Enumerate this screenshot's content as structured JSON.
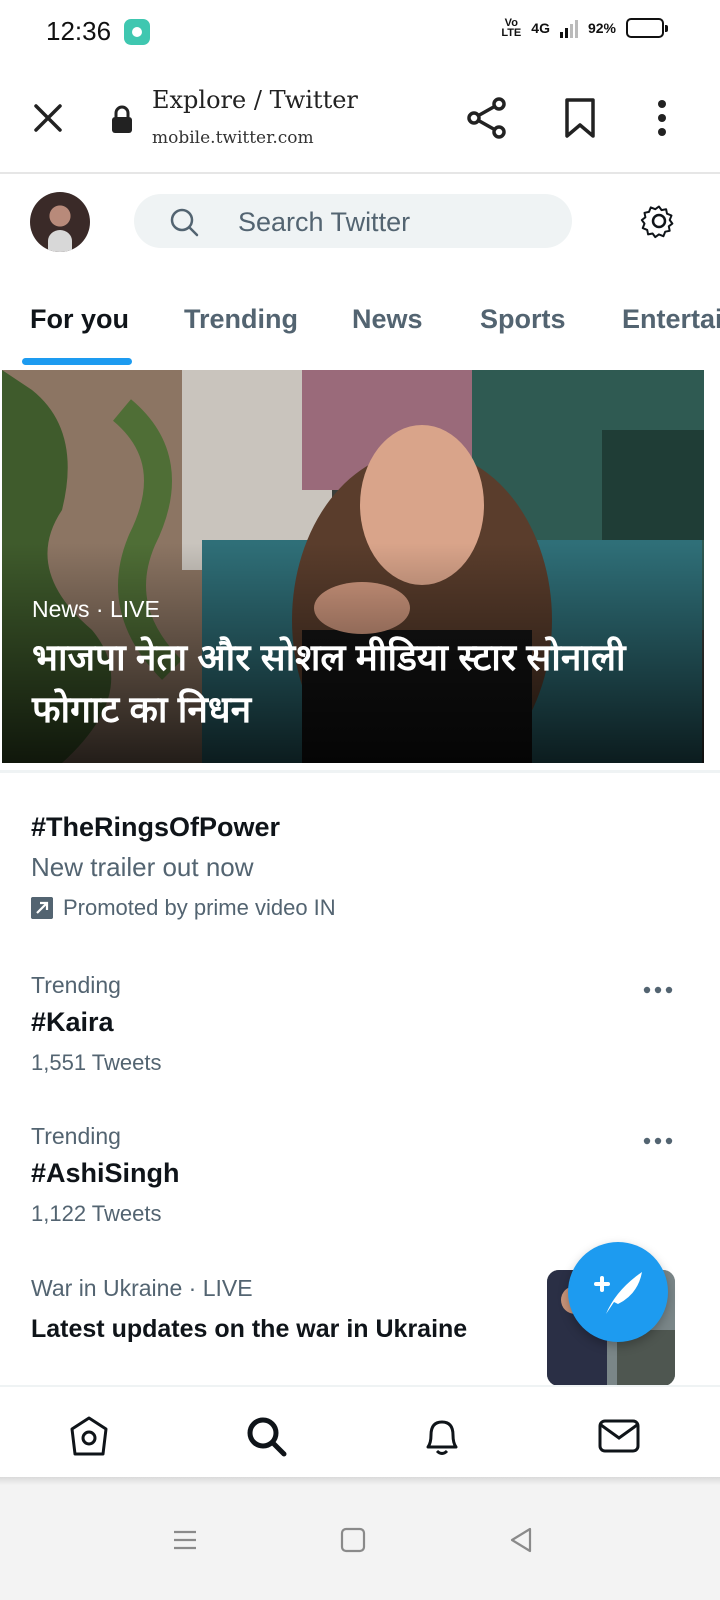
{
  "status_bar": {
    "time": "12:36",
    "volte": "Vo LTE",
    "network": "4G",
    "battery": "92%"
  },
  "browser": {
    "page_title": "Explore / Twitter",
    "url": "mobile.twitter.com"
  },
  "header": {
    "search_placeholder": "Search Twitter"
  },
  "tabs": [
    {
      "label": "For you",
      "active": true
    },
    {
      "label": "Trending",
      "active": false
    },
    {
      "label": "News",
      "active": false
    },
    {
      "label": "Sports",
      "active": false
    },
    {
      "label": "Entertainment",
      "active": false
    }
  ],
  "hero": {
    "category": "News",
    "status": "LIVE",
    "separator": "·",
    "title": "भाजपा नेता और सोशल मीडिया स्टार सोनाली फोगाट का निधन"
  },
  "trends": {
    "promoted": {
      "hashtag": "#TheRingsOfPower",
      "subtitle": "New trailer out now",
      "promoted_by": "Promoted by prime video IN"
    },
    "items": [
      {
        "context": "Trending",
        "name": "#Kaira",
        "count": "1,551 Tweets"
      },
      {
        "context": "Trending",
        "name": "#AshiSingh",
        "count": "1,122 Tweets"
      }
    ],
    "news": {
      "context": "War in Ukraine",
      "separator": "·",
      "status": "LIVE",
      "title": "Latest updates on the war in Ukraine"
    }
  },
  "colors": {
    "accent": "#1d9bf0",
    "text_primary": "#0f1419",
    "text_secondary": "#536471",
    "search_bg": "#eff3f4"
  },
  "icons": {
    "close": "close-icon",
    "lock": "lock-icon",
    "share": "share-icon",
    "bookmark": "bookmark-icon",
    "more": "more-vertical-icon",
    "search": "search-icon",
    "settings": "gear-icon",
    "compose": "compose-tweet-icon",
    "home": "home-icon",
    "explore": "search-icon",
    "notifications": "bell-icon",
    "messages": "mail-icon"
  }
}
